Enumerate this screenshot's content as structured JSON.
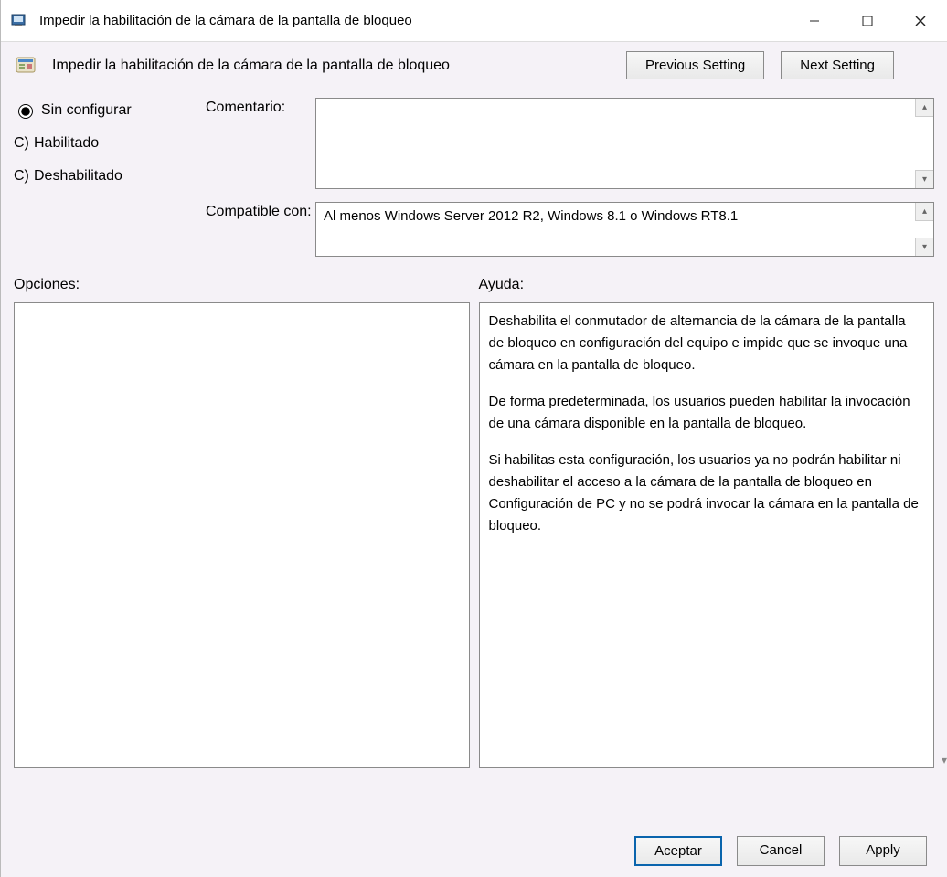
{
  "window": {
    "title": "Impedir la habilitación de la cámara de la pantalla de bloqueo"
  },
  "header": {
    "policy_title": "Impedir la habilitación de la cámara de la pantalla de bloqueo",
    "prev_btn": "Previous Setting",
    "next_btn": "Next Setting"
  },
  "state": {
    "not_configured": "Sin configurar",
    "enabled": "Habilitado",
    "disabled": "Deshabilitado",
    "selected": "not_configured"
  },
  "labels": {
    "comment": "Comentario:",
    "supported": "Compatible con:",
    "options": "Opciones:",
    "help": "Ayuda:"
  },
  "fields": {
    "comment": "",
    "supported": "Al menos Windows Server 2012 R2, Windows 8.1 o Windows RT8.1"
  },
  "help": {
    "p1": "Deshabilita el conmutador de alternancia de la cámara de la pantalla de bloqueo en configuración del equipo e impide que se invoque una cámara en la pantalla de bloqueo.",
    "p2": "De forma predeterminada, los usuarios pueden habilitar la invocación de una cámara disponible en la pantalla de bloqueo.",
    "p3": "Si habilitas esta configuración, los usuarios ya no podrán habilitar ni deshabilitar el acceso a la cámara de la pantalla de bloqueo en Configuración de PC y no se podrá invocar la cámara en la pantalla de bloqueo."
  },
  "footer": {
    "ok": "Aceptar",
    "cancel": "Cancel",
    "apply": "Apply"
  }
}
